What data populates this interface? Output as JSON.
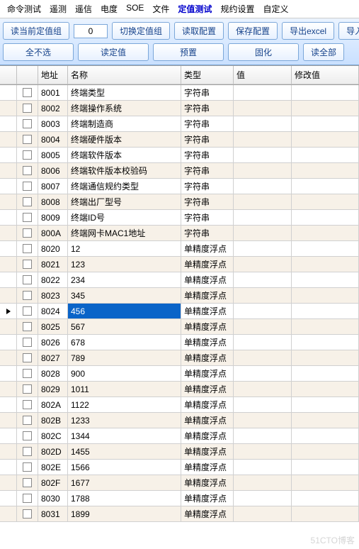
{
  "menu": {
    "items": [
      "命令测试",
      "遥测",
      "遥信",
      "电度",
      "SOE",
      "文件",
      "定值测试",
      "规约设置",
      "自定义"
    ],
    "active_index": 6
  },
  "toolbar": {
    "row1": {
      "read_current_group": "读当前定值组",
      "group_value": "0",
      "switch_group": "切换定值组",
      "read_config": "读取配置",
      "save_config": "保存配置",
      "export_excel": "导出excel",
      "import": "导入"
    },
    "row2": {
      "select_none": "全不选",
      "read_value": "读定值",
      "preset": "预置",
      "solidify": "固化",
      "read_all": "读全部"
    }
  },
  "grid": {
    "headers": {
      "address": "地址",
      "name": "名称",
      "type": "类型",
      "value": "值",
      "mod_value": "修改值"
    },
    "selected_index": 14,
    "rows": [
      {
        "addr": "8001",
        "name": "终端类型",
        "type": "字符串"
      },
      {
        "addr": "8002",
        "name": "终端操作系统",
        "type": "字符串"
      },
      {
        "addr": "8003",
        "name": "终端制造商",
        "type": "字符串"
      },
      {
        "addr": "8004",
        "name": "终端硬件版本",
        "type": "字符串"
      },
      {
        "addr": "8005",
        "name": "终端软件版本",
        "type": "字符串"
      },
      {
        "addr": "8006",
        "name": "终端软件版本校验码",
        "type": "字符串"
      },
      {
        "addr": "8007",
        "name": "终端通信规约类型",
        "type": "字符串"
      },
      {
        "addr": "8008",
        "name": "终端出厂型号",
        "type": "字符串"
      },
      {
        "addr": "8009",
        "name": "终端ID号",
        "type": "字符串"
      },
      {
        "addr": "800A",
        "name": "终端网卡MAC1地址",
        "type": "字符串"
      },
      {
        "addr": "8020",
        "name": "12",
        "type": "单精度浮点"
      },
      {
        "addr": "8021",
        "name": "123",
        "type": "单精度浮点"
      },
      {
        "addr": "8022",
        "name": "234",
        "type": "单精度浮点"
      },
      {
        "addr": "8023",
        "name": "345",
        "type": "单精度浮点"
      },
      {
        "addr": "8024",
        "name": "456",
        "type": "单精度浮点"
      },
      {
        "addr": "8025",
        "name": "567",
        "type": "单精度浮点"
      },
      {
        "addr": "8026",
        "name": "678",
        "type": "单精度浮点"
      },
      {
        "addr": "8027",
        "name": "789",
        "type": "单精度浮点"
      },
      {
        "addr": "8028",
        "name": "900",
        "type": "单精度浮点"
      },
      {
        "addr": "8029",
        "name": "1011",
        "type": "单精度浮点"
      },
      {
        "addr": "802A",
        "name": "1122",
        "type": "单精度浮点"
      },
      {
        "addr": "802B",
        "name": "1233",
        "type": "单精度浮点"
      },
      {
        "addr": "802C",
        "name": "1344",
        "type": "单精度浮点"
      },
      {
        "addr": "802D",
        "name": "1455",
        "type": "单精度浮点"
      },
      {
        "addr": "802E",
        "name": "1566",
        "type": "单精度浮点"
      },
      {
        "addr": "802F",
        "name": "1677",
        "type": "单精度浮点"
      },
      {
        "addr": "8030",
        "name": "1788",
        "type": "单精度浮点"
      },
      {
        "addr": "8031",
        "name": "1899",
        "type": "单精度浮点"
      }
    ]
  },
  "watermark": "51CTO博客"
}
